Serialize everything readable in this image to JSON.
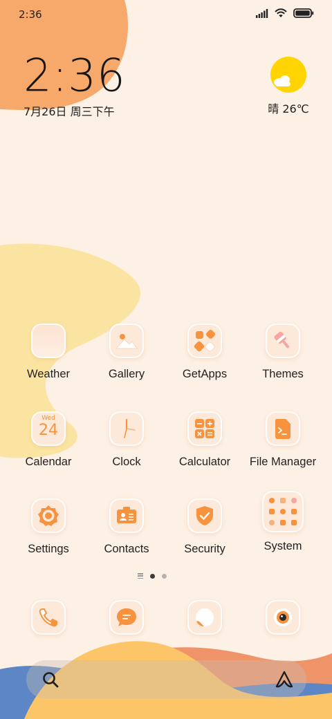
{
  "status_bar": {
    "time": "2:36",
    "icons": [
      "signal-icon",
      "wifi-icon",
      "battery-icon"
    ]
  },
  "clock_widget": {
    "time": "2:36",
    "date": "7月26日 周三下午"
  },
  "weather_widget": {
    "icon": "partly-sunny-icon",
    "text": "晴 26℃"
  },
  "apps": [
    {
      "label": "Weather",
      "icon": "weather-icon"
    },
    {
      "label": "Gallery",
      "icon": "gallery-icon"
    },
    {
      "label": "GetApps",
      "icon": "getapps-icon"
    },
    {
      "label": "Themes",
      "icon": "themes-icon"
    },
    {
      "label": "Calendar",
      "icon": "calendar-icon",
      "icon_day": "Wed",
      "icon_date": "24"
    },
    {
      "label": "Clock",
      "icon": "clock-icon"
    },
    {
      "label": "Calculator",
      "icon": "calculator-icon"
    },
    {
      "label": "File Manager",
      "icon": "file-manager-icon"
    },
    {
      "label": "Settings",
      "icon": "settings-icon"
    },
    {
      "label": "Contacts",
      "icon": "contacts-icon"
    },
    {
      "label": "Security",
      "icon": "security-icon"
    },
    {
      "label": "System",
      "icon": "system-folder-icon"
    }
  ],
  "page_indicator": {
    "pages": 2,
    "current": 1
  },
  "dock": [
    {
      "icon": "phone-icon"
    },
    {
      "icon": "messages-icon"
    },
    {
      "icon": "browser-icon"
    },
    {
      "icon": "camera-icon"
    }
  ],
  "search_bar": {
    "icons": [
      "search-icon",
      "assistant-icon"
    ]
  },
  "colors": {
    "background": "#fdf0e4",
    "accent_orange": "#f7933f",
    "wallpaper_orange": "#f7a96b",
    "wallpaper_yellow": "#fbe4a2",
    "wallpaper_blue": "#5d86c6",
    "sun_yellow": "#ffd400"
  }
}
